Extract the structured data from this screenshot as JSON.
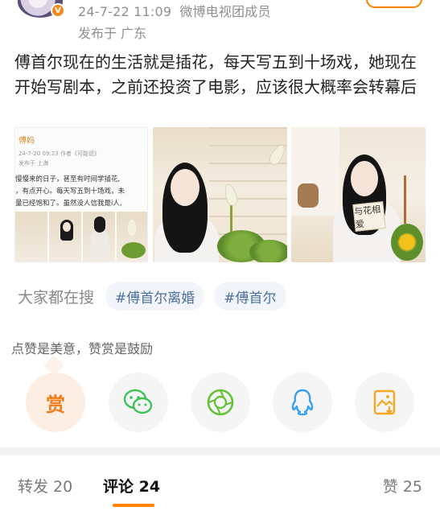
{
  "header": {
    "time": "24-7-22 11:09",
    "user_badge": "微博电视团成员",
    "location": "发布于 广东"
  },
  "post": {
    "text": "傅首尔现在的生活就是插花，每天写五到十场戏，她现在开始写剧本，之前还投资了电影，应该很大概率会转幕后"
  },
  "image1": {
    "author": "傅妈",
    "meta": "24-7-20 09:23  作者《可能说》",
    "location": "发布于 上海",
    "lines": [
      "慢慢来的日子，甚至有时间学插花,",
      "，有点开心。每天写五到十场戏，未",
      "量已经饱和了。虽然没人信我是i人,"
    ]
  },
  "image3": {
    "sign_text": "与花相爱"
  },
  "search": {
    "label": "大家都在搜",
    "tags": [
      "#傅首尔离婚",
      "#傅首尔"
    ]
  },
  "reward": {
    "hint": "点赞是美意，赞赏是鼓励",
    "reward_char": "赏"
  },
  "tabs": {
    "repost": "转发 20",
    "comments": "评论 24",
    "likes": "赞 25"
  },
  "colors": {
    "accent": "#ff8200",
    "link": "#4a6fa0",
    "wechat": "#3bc35a",
    "moments": "#67c23a",
    "qq": "#3aa0f0",
    "save": "#f5a623"
  },
  "icons": {
    "reward": "reward-icon",
    "wechat": "wechat-icon",
    "moments": "moments-icon",
    "qq": "qq-icon",
    "save": "save-image-icon"
  }
}
